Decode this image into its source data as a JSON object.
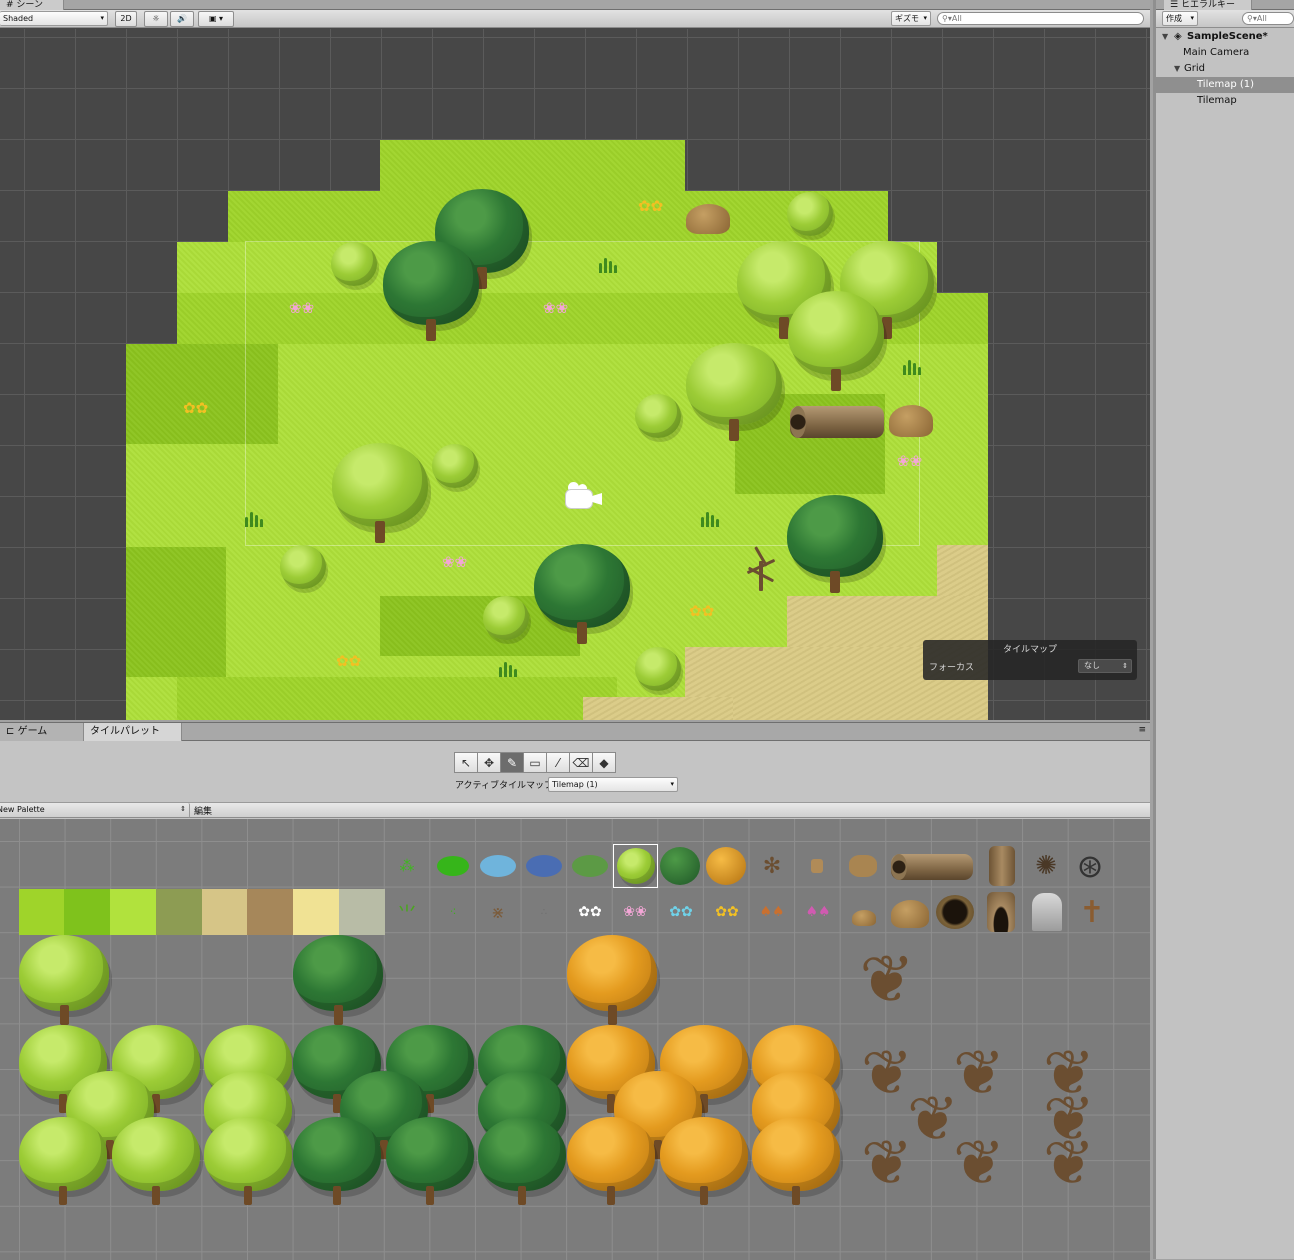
{
  "scene": {
    "tab_label": "シーン",
    "shading_mode": "Shaded",
    "mode_2d": "2D",
    "gizmos_label": "ギズモ",
    "search_placeholder": "All"
  },
  "hierarchy": {
    "tab_label": "ヒエラルキー",
    "create_label": "作成",
    "search_placeholder": "All",
    "items": [
      {
        "label": "SampleScene*"
      },
      {
        "label": "Main Camera"
      },
      {
        "label": "Grid"
      },
      {
        "label": "Tilemap (1)"
      },
      {
        "label": "Tilemap"
      }
    ]
  },
  "tilemap_overlay": {
    "title": "タイルマップ",
    "focus_label": "フォーカス",
    "focus_value": "なし"
  },
  "bottom": {
    "tabs": [
      {
        "label": "ゲーム"
      },
      {
        "label": "タイルパレット"
      }
    ],
    "active_tilemap_label": "アクティブタイルマップ",
    "active_tilemap_value": "Tilemap (1)",
    "palette_name": "New Palette",
    "edit_label": "編集",
    "tools": [
      {
        "icon": "select-arrow-icon"
      },
      {
        "icon": "move-icon"
      },
      {
        "icon": "brush-icon"
      },
      {
        "icon": "box-fill-icon"
      },
      {
        "icon": "picker-icon"
      },
      {
        "icon": "eraser-icon"
      },
      {
        "icon": "fill-bucket-icon"
      }
    ]
  },
  "colors": {
    "grass": "#9fd42a",
    "sand": "#d9c983",
    "selection": "#8f8f8f",
    "scene_bg": "#474747"
  }
}
